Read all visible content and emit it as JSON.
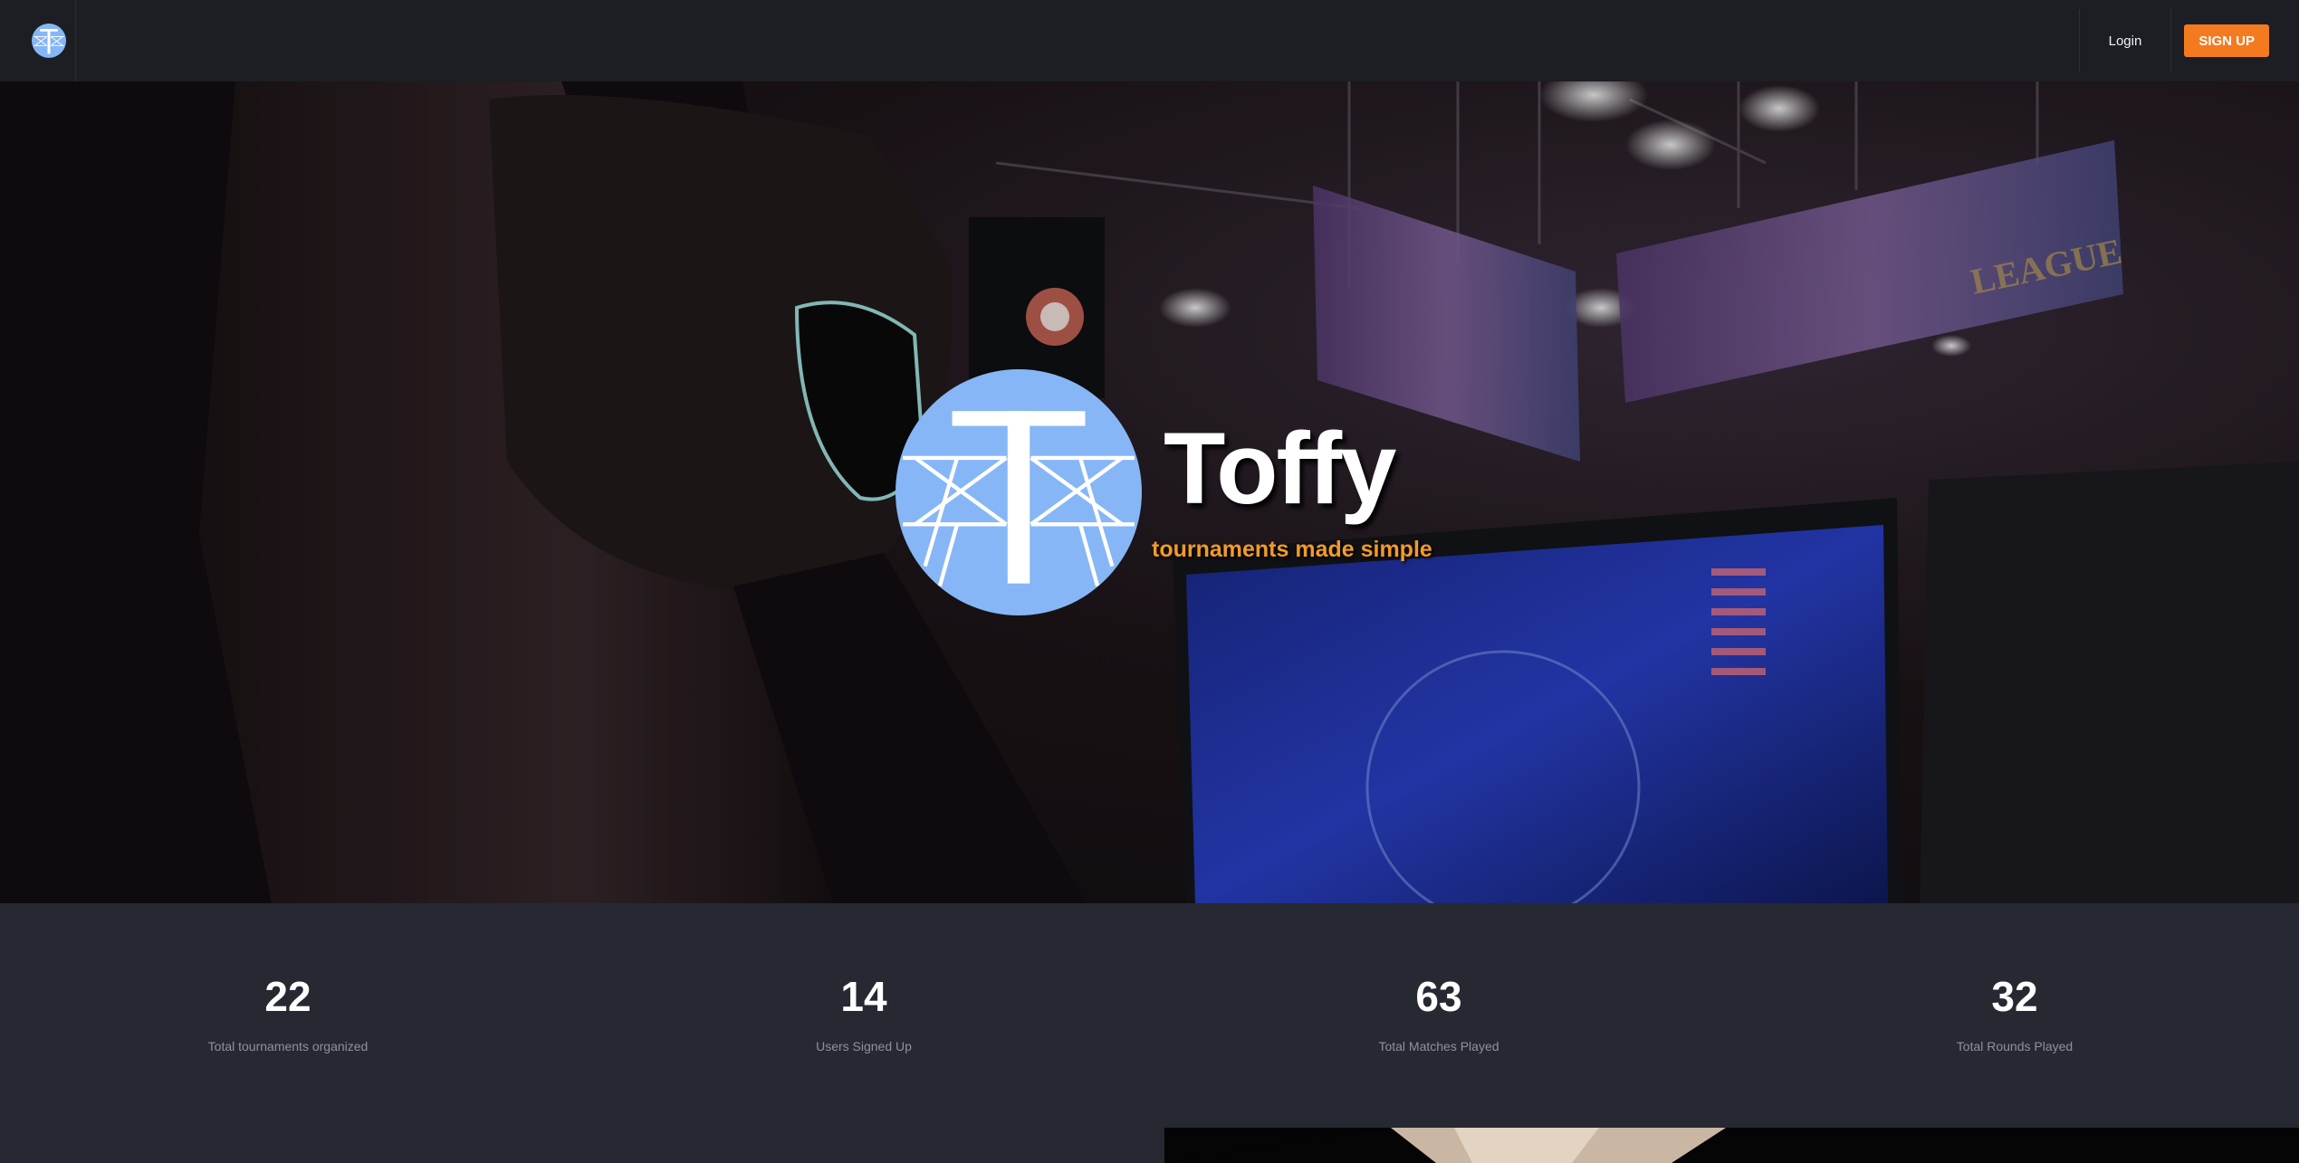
{
  "app": {
    "brand": "Toffy",
    "tagline": "tournaments made simple",
    "accent_color": "#f47a20",
    "tagline_color": "#f39a28",
    "logo_color": "#86b6f6"
  },
  "nav": {
    "logo_icon": "toffy-logo-icon",
    "login_label": "Login",
    "signup_label": "SIGN UP"
  },
  "hero": {
    "background": "esports-gamer-photo",
    "logo_icon": "toffy-logo-icon"
  },
  "stats": [
    {
      "value": "22",
      "label": "Total tournaments organized"
    },
    {
      "value": "14",
      "label": "Users Signed Up"
    },
    {
      "value": "63",
      "label": "Total Matches Played"
    },
    {
      "value": "32",
      "label": "Total Rounds Played"
    }
  ]
}
